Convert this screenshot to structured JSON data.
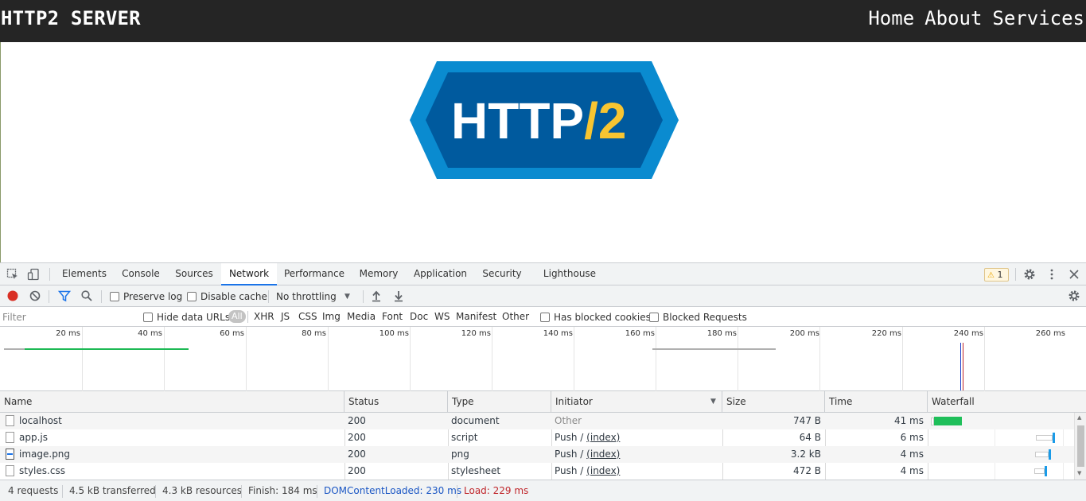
{
  "site": {
    "brand": "HTTP2 SERVER",
    "nav": [
      "Home",
      "About",
      "Services"
    ],
    "logo": {
      "text_main": "HTTP",
      "text_slash": "/",
      "text_num": "2",
      "outer_color": "#0a8bd0",
      "inner_color": "#005a9e",
      "slash_color": "#f7c531"
    }
  },
  "devtools": {
    "tabs": [
      "Elements",
      "Console",
      "Sources",
      "Network",
      "Performance",
      "Memory",
      "Application",
      "Security",
      "Lighthouse"
    ],
    "active_tab": "Network",
    "warning_count": "1",
    "toolbar": {
      "preserve_log": "Preserve log",
      "disable_cache": "Disable cache",
      "throttling": "No throttling"
    },
    "filter": {
      "placeholder": "Filter",
      "hide_data_urls": "Hide data URLs",
      "types": [
        "All",
        "XHR",
        "JS",
        "CSS",
        "Img",
        "Media",
        "Font",
        "Doc",
        "WS",
        "Manifest",
        "Other"
      ],
      "has_blocked_cookies": "Has blocked cookies",
      "blocked_requests": "Blocked Requests"
    },
    "overview": {
      "ticks": [
        "20 ms",
        "40 ms",
        "60 ms",
        "80 ms",
        "100 ms",
        "120 ms",
        "140 ms",
        "160 ms",
        "180 ms",
        "200 ms",
        "220 ms",
        "240 ms",
        "260 ms"
      ],
      "colors": {
        "download": "#1db954",
        "waiting": "#b0b0b0",
        "dom_content_loaded": "#1a3fcc",
        "load": "#c0262b"
      }
    },
    "table": {
      "columns": [
        "Name",
        "Status",
        "Type",
        "Initiator",
        "Size",
        "Time",
        "Waterfall"
      ],
      "rows": [
        {
          "name": "localhost",
          "status": "200",
          "type": "document",
          "initiator": "Other",
          "initiator_link": "",
          "size": "747 B",
          "time": "41 ms",
          "icon": "file-icon"
        },
        {
          "name": "app.js",
          "status": "200",
          "type": "script",
          "initiator": "Push / ",
          "initiator_link": "(index)",
          "size": "64 B",
          "time": "6 ms",
          "icon": "file-icon"
        },
        {
          "name": "image.png",
          "status": "200",
          "type": "png",
          "initiator": "Push / ",
          "initiator_link": "(index)",
          "size": "3.2 kB",
          "time": "4 ms",
          "icon": "image-file-icon"
        },
        {
          "name": "styles.css",
          "status": "200",
          "type": "stylesheet",
          "initiator": "Push / ",
          "initiator_link": "(index)",
          "size": "472 B",
          "time": "4 ms",
          "icon": "file-icon"
        }
      ]
    },
    "summary": {
      "requests": "4 requests",
      "transferred": "4.5 kB transferred",
      "resources": "4.3 kB resources",
      "finish": "Finish: 184 ms",
      "dom_content_loaded": "DOMContentLoaded: 230 ms",
      "load": "Load: 229 ms",
      "dcl_color": "#1a56c4",
      "load_color": "#c0262b"
    }
  }
}
